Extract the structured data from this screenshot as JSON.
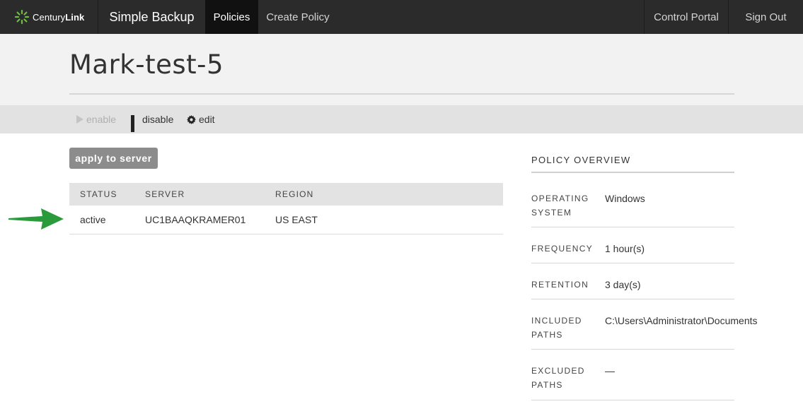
{
  "nav": {
    "brand_light": "Century",
    "brand_bold": "Link",
    "app_name": "Simple Backup",
    "policies": "Policies",
    "create_policy": "Create Policy",
    "control_portal": "Control Portal",
    "sign_out": "Sign Out"
  },
  "page": {
    "title": "Mark-test-5"
  },
  "toolbar": {
    "enable": "enable",
    "disable": "disable",
    "edit": "edit"
  },
  "apply_button": "apply to server",
  "servers": {
    "headers": [
      "STATUS",
      "SERVER",
      "REGION"
    ],
    "rows": [
      {
        "status": "active",
        "server": "UC1BAAQKRAMER01",
        "region": "US EAST"
      }
    ]
  },
  "overview": {
    "title": "POLICY OVERVIEW",
    "os_label_1": "OPERATING",
    "os_label_2": "SYSTEM",
    "os_value": "Windows",
    "freq_label": "FREQUENCY",
    "freq_value": "1 hour(s)",
    "ret_label": "RETENTION",
    "ret_value": "3 day(s)",
    "inc_label_1": "INCLUDED",
    "inc_label_2": "PATHS",
    "inc_value": "C:\\Users\\Administrator\\Documents",
    "exc_label_1": "EXCLUDED",
    "exc_label_2": "PATHS",
    "exc_value": "—"
  },
  "colors": {
    "navbar": "#2b2b2b",
    "accent_green": "#2a9a3a",
    "logo_green": "#6fbd44"
  },
  "icons": {
    "logo": "centurylink-logo-icon",
    "enable": "play-icon",
    "disable": "pause-icon",
    "edit": "gear-icon",
    "pointer": "green-arrow-icon"
  }
}
